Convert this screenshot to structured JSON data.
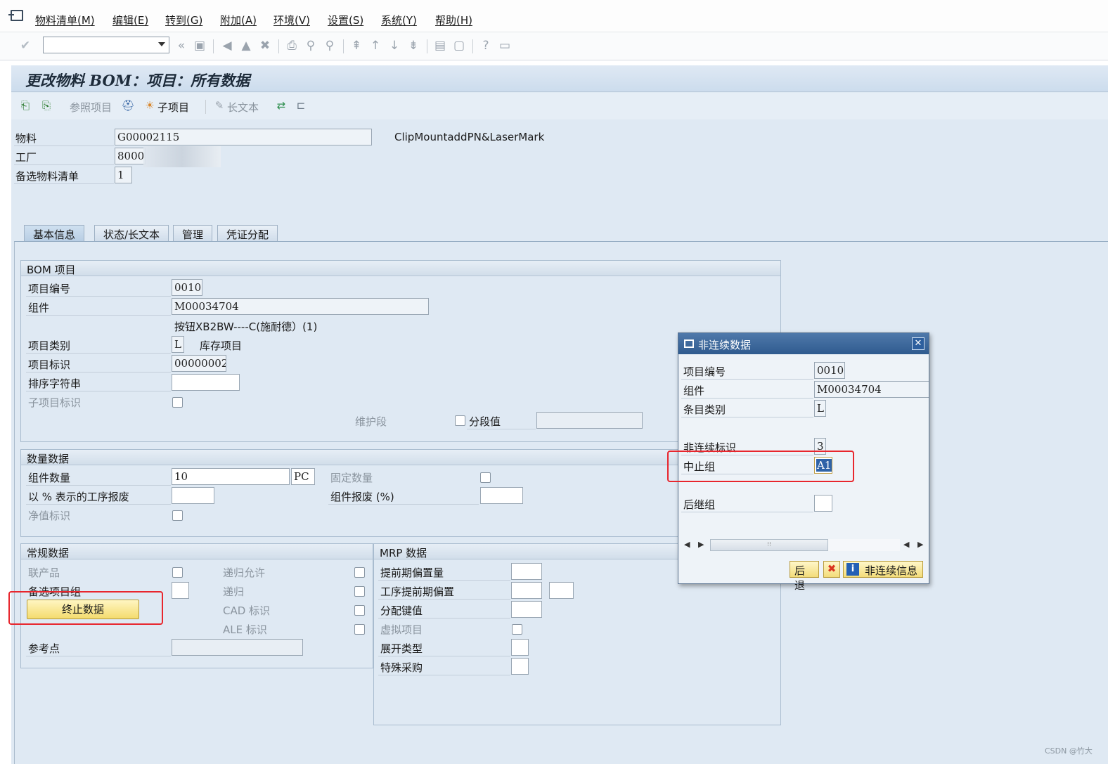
{
  "menubar": {
    "items": [
      "物料清单(M)",
      "编辑(E)",
      "转到(G)",
      "附加(A)",
      "环境(V)",
      "设置(S)",
      "系统(Y)",
      "帮助(H)"
    ]
  },
  "toolbar": {
    "command_field_value": "",
    "icons": [
      "check-icon",
      "back-double-icon",
      "save-icon",
      "back-icon",
      "exit-icon",
      "cancel-icon",
      "print-icon",
      "find-icon",
      "find-next-icon",
      "first-page-icon",
      "prev-page-icon",
      "next-page-icon",
      "last-page-icon",
      "new-session-icon",
      "shortcut-icon",
      "help-icon",
      "customize-icon"
    ]
  },
  "page": {
    "title": "更改物料 BOM：项目：所有数据"
  },
  "app_toolbar": {
    "ref_item_label": "参照项目",
    "sub_item_label": "子项目",
    "long_text_label": "长文本"
  },
  "header": {
    "material_label": "物料",
    "material_value": "G00002115",
    "material_desc": "ClipMountaddPN&LaserMark",
    "plant_label": "工厂",
    "plant_value": "8000",
    "alt_bom_label": "备选物料清单",
    "alt_bom_value": "1"
  },
  "tabs": [
    "基本信息",
    "状态/长文本",
    "管理",
    "凭证分配"
  ],
  "bom_item": {
    "title": "BOM 项目",
    "item_no_label": "项目编号",
    "item_no_value": "0010",
    "component_label": "组件",
    "component_value": "M00034704",
    "component_desc": "按钮XB2BW----C(施耐德）(1)",
    "item_cat_label": "项目类别",
    "item_cat_value": "L",
    "item_cat_desc": "库存项目",
    "item_id_label": "项目标识",
    "item_id_value": "00000002",
    "sort_string_label": "排序字符串",
    "sub_item_id_label": "子项目标识",
    "maint_label": "维护段",
    "segment_label": "分段值"
  },
  "qty_data": {
    "title": "数量数据",
    "comp_qty_label": "组件数量",
    "comp_qty_value": "10",
    "unit_value": "PC",
    "fixed_qty_label": "固定数量",
    "op_scrap_label": "以 % 表示的工序报废",
    "comp_scrap_label": "组件报废 (%)",
    "net_id_label": "净值标识"
  },
  "general_data": {
    "title": "常规数据",
    "coproduct_label": "联产品",
    "alt_group_label": "备选项目组",
    "recursive_allowed_label": "递归允许",
    "recursive_label": "递归",
    "cad_label": "CAD 标识",
    "ale_label": "ALE 标识",
    "ref_point_label": "参考点",
    "stop_button_label": "终止数据"
  },
  "mrp_data": {
    "title": "MRP 数据",
    "lead_offset_label": "提前期偏置量",
    "op_lead_offset_label": "工序提前期偏置",
    "dist_key_label": "分配键值",
    "phantom_label": "虚拟项目",
    "explosion_label": "展开类型",
    "special_proc_label": "特殊采购"
  },
  "dialog": {
    "title": "非连续数据",
    "item_no_label": "项目编号",
    "item_no_value": "0010",
    "component_label": "组件",
    "component_value": "M00034704",
    "item_cat_label": "条目类别",
    "item_cat_value": "L",
    "discont_label": "非连续标识",
    "discont_value": "3",
    "stop_group_label": "中止组",
    "stop_group_value": "A1",
    "follow_group_label": "后继组",
    "follow_group_value": "",
    "back_button": "后退",
    "discont_info_button": "非连续信息"
  },
  "watermark": "CSDN @竹大",
  "colors": {
    "screen_bg": "#dfe9f3",
    "dialog_title": "#2f5b8f",
    "highlight_red": "#e8262d",
    "button_yellow": "#f4dc6e"
  }
}
